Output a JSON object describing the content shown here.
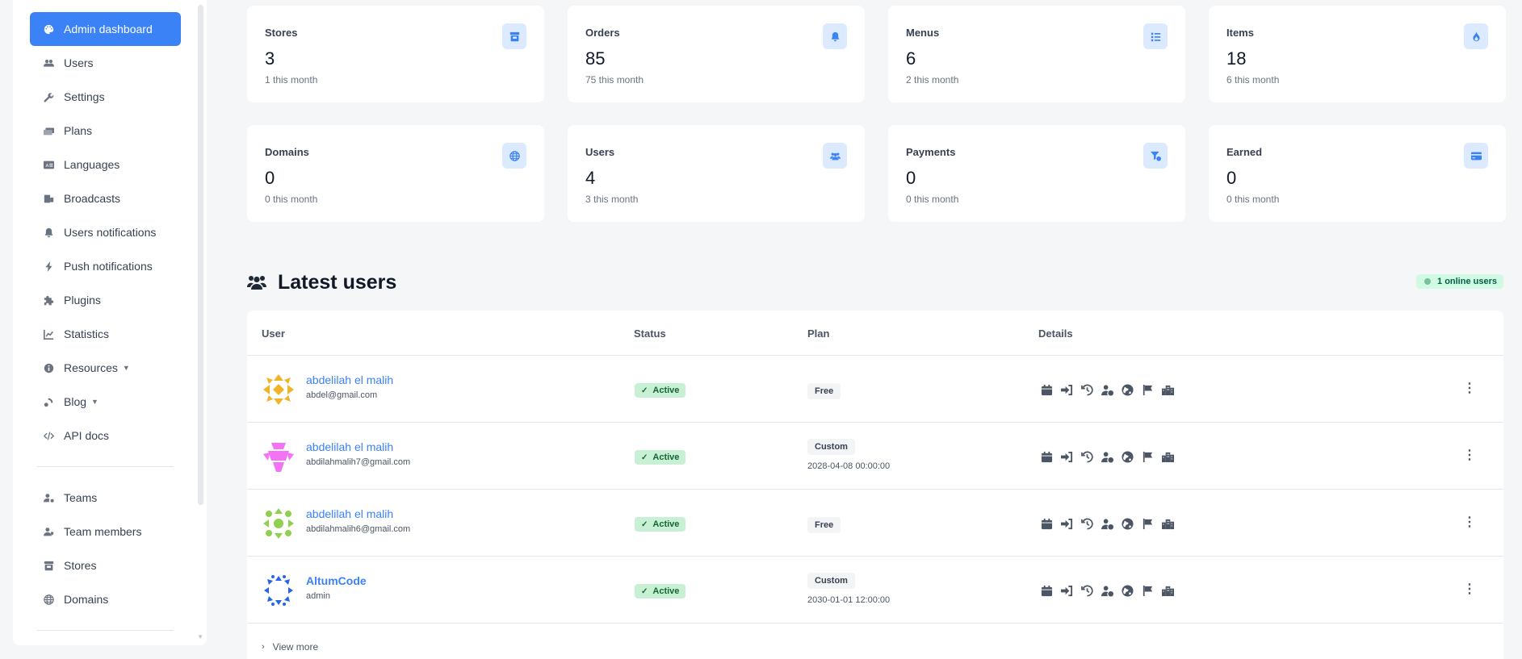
{
  "sidebar": {
    "items": [
      {
        "label": "Admin dashboard",
        "icon": "palette-icon",
        "active": true
      },
      {
        "label": "Users",
        "icon": "users-icon"
      },
      {
        "label": "Settings",
        "icon": "wrench-icon"
      },
      {
        "label": "Plans",
        "icon": "money-bills-icon"
      },
      {
        "label": "Languages",
        "icon": "language-icon"
      },
      {
        "label": "Broadcasts",
        "icon": "broadcast-icon"
      },
      {
        "label": "Users notifications",
        "icon": "bell-icon"
      },
      {
        "label": "Push notifications",
        "icon": "bolt-icon"
      },
      {
        "label": "Plugins",
        "icon": "puzzle-icon"
      },
      {
        "label": "Statistics",
        "icon": "chart-icon"
      },
      {
        "label": "Resources",
        "icon": "info-icon",
        "caret": true
      },
      {
        "label": "Blog",
        "icon": "blog-icon",
        "caret": true
      },
      {
        "label": "API docs",
        "icon": "code-icon"
      }
    ],
    "items2": [
      {
        "label": "Teams",
        "icon": "user-cog-icon"
      },
      {
        "label": "Team members",
        "icon": "user-tag-icon"
      },
      {
        "label": "Stores",
        "icon": "store-icon"
      },
      {
        "label": "Domains",
        "icon": "globe-icon"
      }
    ]
  },
  "stats": [
    {
      "title": "Stores",
      "value": "3",
      "sub": "1 this month",
      "icon": "store-icon"
    },
    {
      "title": "Orders",
      "value": "85",
      "sub": "75 this month",
      "icon": "bell-icon"
    },
    {
      "title": "Menus",
      "value": "6",
      "sub": "2 this month",
      "icon": "list-icon"
    },
    {
      "title": "Items",
      "value": "18",
      "sub": "6 this month",
      "icon": "fire-icon"
    },
    {
      "title": "Domains",
      "value": "0",
      "sub": "0 this month",
      "icon": "globe-icon"
    },
    {
      "title": "Users",
      "value": "4",
      "sub": "3 this month",
      "icon": "users-icon"
    },
    {
      "title": "Payments",
      "value": "0",
      "sub": "0 this month",
      "icon": "funnel-dollar-icon"
    },
    {
      "title": "Earned",
      "value": "0",
      "sub": "0 this month",
      "icon": "credit-card-icon"
    }
  ],
  "latest_users": {
    "title": "Latest users",
    "online_badge": "1 online users",
    "columns": [
      "User",
      "Status",
      "Plan",
      "Details"
    ],
    "rows": [
      {
        "name": "abdelilah el malih",
        "email": "abdel@gmail.com",
        "status": "Active",
        "plan": "Free",
        "plan_date": "",
        "avatar_color": "#f0b429"
      },
      {
        "name": "abdelilah el malih",
        "email": "abdilahmalih7@gmail.com",
        "status": "Active",
        "plan": "Custom",
        "plan_date": "2028-04-08 00:00:00",
        "avatar_color": "#f472f6"
      },
      {
        "name": "abdelilah el malih",
        "email": "abdilahmalih6@gmail.com",
        "status": "Active",
        "plan": "Free",
        "plan_date": "",
        "avatar_color": "#8fd14f"
      },
      {
        "name": "AltumCode",
        "email": "admin",
        "status": "Active",
        "plan": "Custom",
        "plan_date": "2030-01-01 12:00:00",
        "avatar_color": "#2563eb"
      }
    ],
    "view_more": "View more"
  },
  "colors": {
    "accent": "#3b82f6",
    "active_badge": "#c8f0d5",
    "icon_bg": "#dbeafe"
  }
}
